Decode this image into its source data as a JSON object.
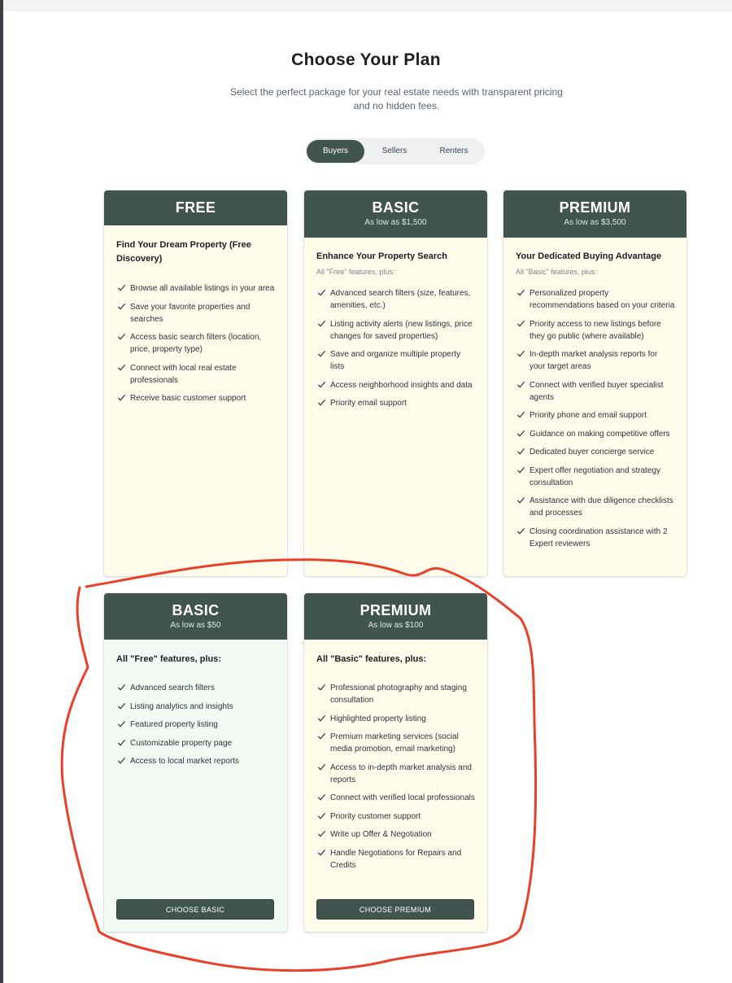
{
  "page": {
    "title": "Choose Your Plan",
    "subtitle": "Select the perfect package for your real estate needs with transparent pricing and no hidden fees."
  },
  "tabs": [
    {
      "label": "Buyers",
      "active": true
    },
    {
      "label": "Sellers",
      "active": false
    },
    {
      "label": "Renters",
      "active": false
    }
  ],
  "colors": {
    "header": "#42544f",
    "card_cream": "#fffcec",
    "card_mint": "#f1fbf4",
    "annotation_stroke": "#e8402a"
  },
  "buyer_plans": [
    {
      "title": "FREE",
      "price": "",
      "subtitle": "Find Your Dream Property (Free Discovery)",
      "note": "",
      "features": [
        "Browse all available listings in your area",
        "Save your favorite properties and searches",
        "Access basic search filters (location, price, property type)",
        "Connect with local real estate professionals",
        "Receive basic customer support"
      ]
    },
    {
      "title": "BASIC",
      "price": "As low as $1,500",
      "subtitle": "Enhance Your Property Search",
      "note": "All \"Free\" features, plus:",
      "features": [
        "Advanced search filters (size, features, amenities, etc.)",
        "Listing activity alerts (new listings, price changes for saved properties)",
        "Save and organize multiple property lists",
        "Access neighborhood insights and data",
        "Priority email support"
      ]
    },
    {
      "title": "PREMIUM",
      "price": "As low as $3,500",
      "subtitle": "Your Dedicated Buying Advantage",
      "note": "All \"Basic\" features, plus:",
      "features": [
        "Personalized property recommendations based on your criteria",
        "Priority access to new listings before they go public (where available)",
        "In-depth market analysis reports for your target areas",
        "Connect with verified buyer specialist agents",
        "Priority phone and email support",
        "Guidance on making competitive offers",
        "Dedicated buyer concierge service",
        "Expert offer negotiation and strategy consultation",
        "Assistance with due diligence checklists and processes",
        "Closing coordination assistance with 2 Expert reviewers"
      ]
    }
  ],
  "seller_plans": [
    {
      "title": "BASIC",
      "price": "As low as $50",
      "subtitle": "All \"Free\" features, plus:",
      "features": [
        "Advanced search filters",
        "Listing analytics and insights",
        "Featured property listing",
        "Customizable property page",
        "Access to local market reports"
      ],
      "button": "CHOOSE BASIC"
    },
    {
      "title": "PREMIUM",
      "price": "As low as $100",
      "subtitle": "All \"Basic\" features, plus:",
      "features": [
        "Professional photography and staging consultation",
        "Highlighted property listing",
        "Premium marketing services (social media promotion, email marketing)",
        "Access to in-depth market analysis and reports",
        "Connect with verified local professionals",
        "Priority customer support",
        "Write up Offer & Negotiation",
        "Handle Negotiations for Repairs and Credits"
      ],
      "button": "CHOOSE PREMIUM"
    }
  ]
}
